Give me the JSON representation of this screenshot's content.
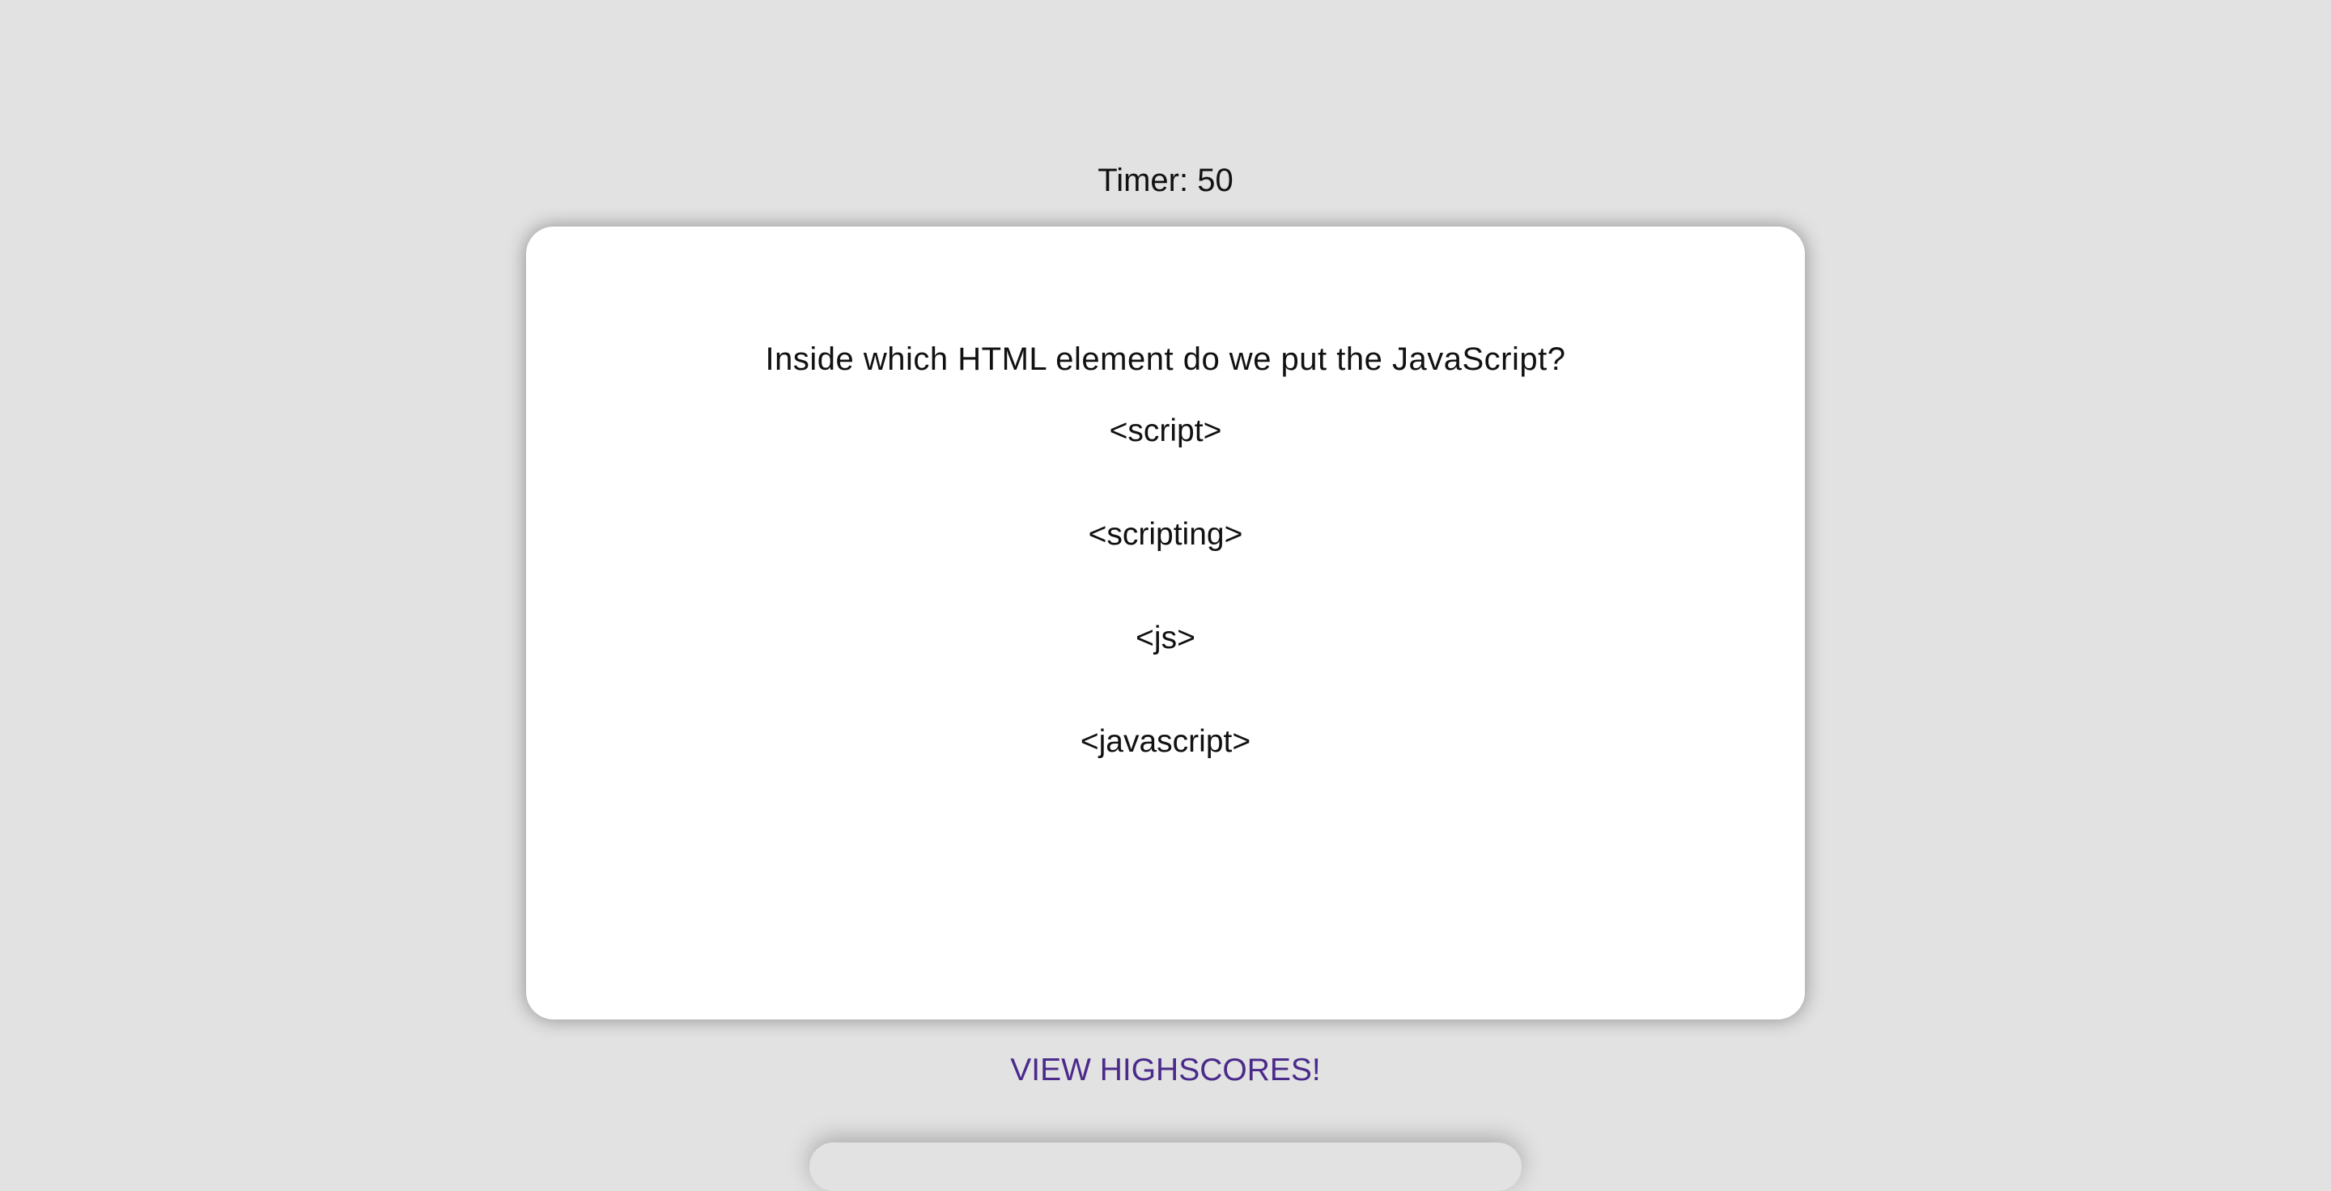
{
  "timer": {
    "label": "Timer: 50"
  },
  "quiz": {
    "question": "Inside which HTML element do we put the JavaScript?",
    "choices": [
      "<script>",
      "<scripting>",
      "<js>",
      "<javascript>"
    ]
  },
  "footer": {
    "highscores_link": "VIEW HIGHSCORES!"
  },
  "colors": {
    "background": "#e2e2e2",
    "card": "#ffffff",
    "link": "#4a2a8a"
  }
}
